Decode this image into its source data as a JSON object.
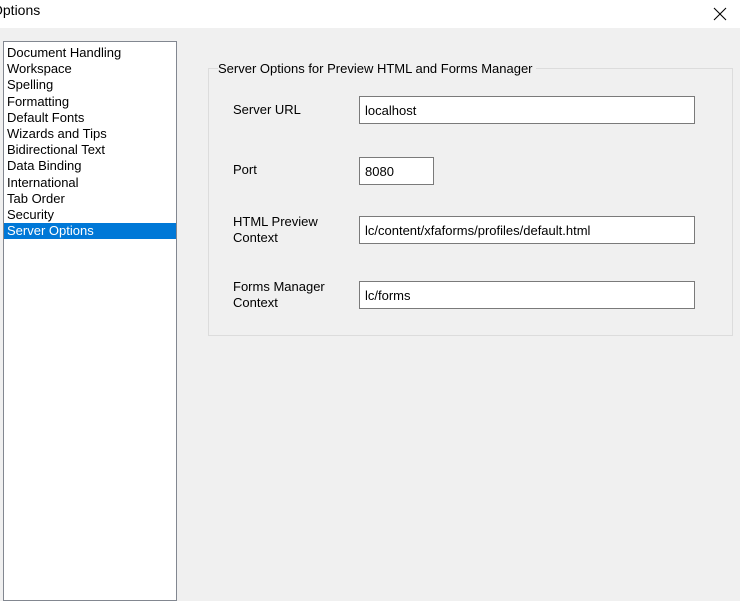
{
  "window": {
    "title": "Options"
  },
  "categories": [
    {
      "label": "Document Handling",
      "selected": false
    },
    {
      "label": "Workspace",
      "selected": false
    },
    {
      "label": "Spelling",
      "selected": false
    },
    {
      "label": "Formatting",
      "selected": false
    },
    {
      "label": "Default Fonts",
      "selected": false
    },
    {
      "label": "Wizards and Tips",
      "selected": false
    },
    {
      "label": "Bidirectional Text",
      "selected": false
    },
    {
      "label": "Data Binding",
      "selected": false
    },
    {
      "label": "International",
      "selected": false
    },
    {
      "label": "Tab Order",
      "selected": false
    },
    {
      "label": "Security",
      "selected": false
    },
    {
      "label": "Server Options",
      "selected": true
    }
  ],
  "server_options": {
    "group_title": "Server Options for Preview HTML and Forms Manager",
    "server_url": {
      "label": "Server URL",
      "value": "localhost"
    },
    "port": {
      "label": "Port",
      "value": "8080"
    },
    "html_preview_context": {
      "label_line1": "HTML Preview",
      "label_line2": "Context",
      "value": "lc/content/xfaforms/profiles/default.html"
    },
    "forms_manager_context": {
      "label_line1": "Forms Manager",
      "label_line2": "Context",
      "value": "lc/forms"
    }
  },
  "colors": {
    "selection": "#0078d7",
    "dialog_background": "#f0f0f0"
  },
  "icons": {
    "close": "close-icon"
  }
}
